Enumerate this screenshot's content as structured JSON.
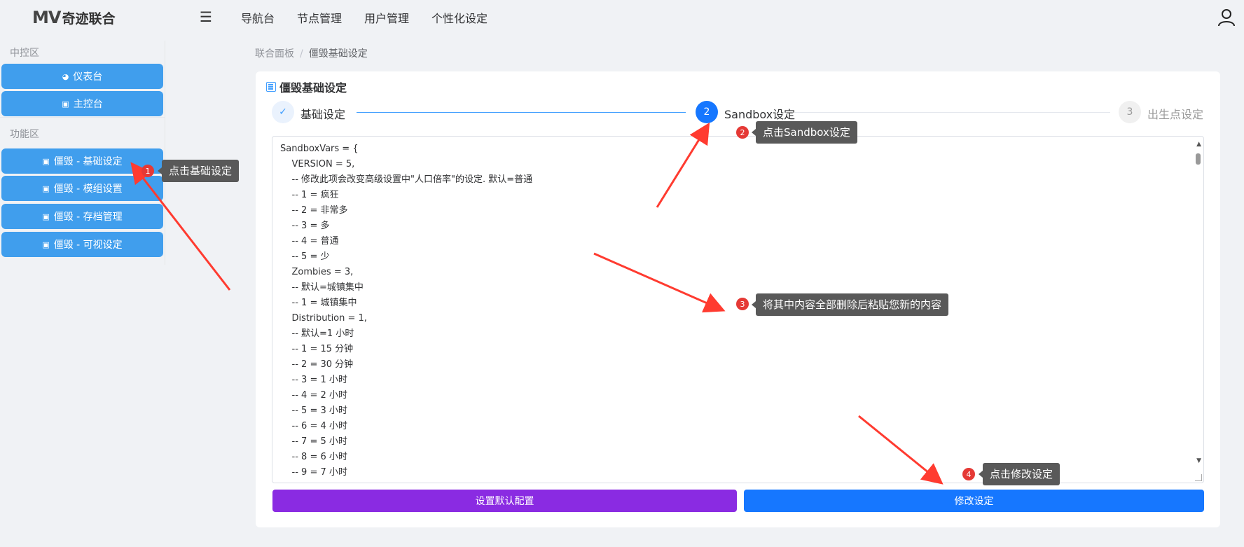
{
  "header": {
    "logo_mark": "MV",
    "logo_text": "奇迹联合",
    "nav": [
      "导航台",
      "节点管理",
      "用户管理",
      "个性化设定"
    ]
  },
  "sidebar": {
    "group1": "中控区",
    "group2": "功能区",
    "items": [
      {
        "label": "仪表台",
        "icon": "pie-chart-icon"
      },
      {
        "label": "主控台",
        "icon": "terminal-icon"
      },
      {
        "label": "僵毁 - 基础设定",
        "icon": "terminal-icon"
      },
      {
        "label": "僵毁 - 模组设置",
        "icon": "terminal-icon"
      },
      {
        "label": "僵毁 - 存档管理",
        "icon": "terminal-icon"
      },
      {
        "label": "僵毁 - 可视设定",
        "icon": "terminal-icon"
      }
    ]
  },
  "breadcrumb": {
    "root": "联合面板",
    "sep": "/",
    "current": "僵毁基础设定"
  },
  "card": {
    "title": "僵毁基础设定"
  },
  "steps": [
    {
      "index": "✓",
      "label": "基础设定",
      "state": "done"
    },
    {
      "index": "2",
      "label": "Sandbox设定",
      "state": "active"
    },
    {
      "index": "3",
      "label": "出生点设定",
      "state": "pending"
    }
  ],
  "editor": {
    "content": "SandboxVars = {\n    VERSION = 5,\n    -- 修改此项会改变高级设置中\"人口倍率\"的设定. 默认=普通\n    -- 1 = 疯狂\n    -- 2 = 非常多\n    -- 3 = 多\n    -- 4 = 普通\n    -- 5 = 少\n    Zombies = 3,\n    -- 默认=城镇集中\n    -- 1 = 城镇集中\n    Distribution = 1,\n    -- 默认=1 小时\n    -- 1 = 15 分钟\n    -- 2 = 30 分钟\n    -- 3 = 1 小时\n    -- 4 = 2 小时\n    -- 5 = 3 小时\n    -- 6 = 4 小时\n    -- 7 = 5 小时\n    -- 8 = 6 小时\n    -- 9 = 7 小时"
  },
  "buttons": {
    "set_default": "设置默认配置",
    "save": "修改设定"
  },
  "annotations": [
    {
      "num": "1",
      "text": "点击基础设定"
    },
    {
      "num": "2",
      "text": "点击Sandbox设定"
    },
    {
      "num": "3",
      "text": "将其中内容全部删除后粘贴您新的内容"
    },
    {
      "num": "4",
      "text": "点击修改设定"
    }
  ],
  "colors": {
    "primary": "#1677ff",
    "sidebar_btn": "#409eed",
    "purple": "#8a2be2",
    "annotation_red": "#e53935",
    "arrow_red": "#ff3b30"
  }
}
